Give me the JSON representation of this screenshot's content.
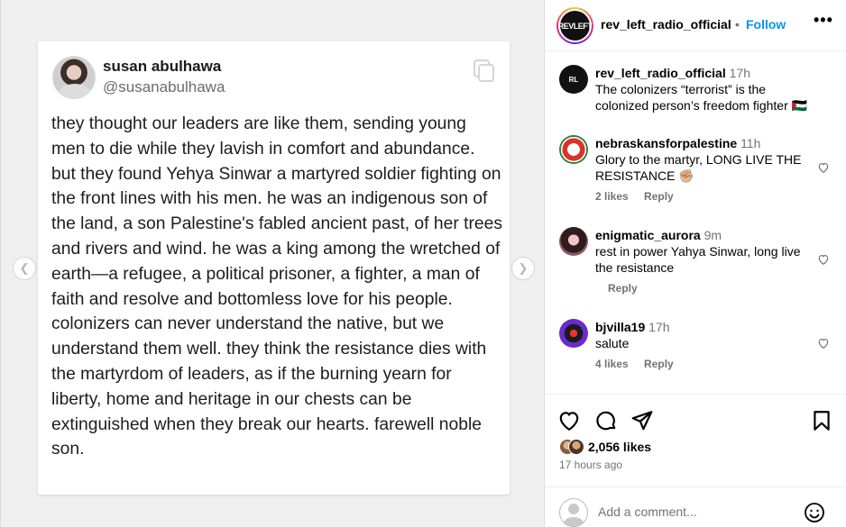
{
  "tweet": {
    "name": "susan abulhawa",
    "handle": "@susanabulhawa",
    "text": "they thought our leaders are like them, sending young men to die while they lavish in comfort and abundance. but they found Yehya Sinwar a martyred soldier fighting on the front lines with his men. he was an indigenous son of the land, a son Palestine's fabled ancient past, of her trees and rivers and wind. he was a king among the wretched of earth—a refugee, a political prisoner, a fighter, a man of faith and resolve and bottomless love for his people. colonizers can never understand the native, but we understand them well. they think the resistance dies with the martyrdom of leaders, as if the burning yearn for liberty, home and heritage in our chests can be extinguished when they break our hearts. farewell noble son."
  },
  "carousel": {
    "prev_icon": "chevron-left-icon",
    "next_icon": "chevron-right-icon"
  },
  "post": {
    "username": "rev_left_radio_official",
    "separator": "•",
    "follow_label": "Follow",
    "more_label": "•••",
    "avatar_text": "REVLEFT"
  },
  "comments": [
    {
      "user": "rev_left_radio_official",
      "time": "17h",
      "text": "The colonizers “terrorist” is the colonized person’s freedom fighter 🇵🇸",
      "likes": "",
      "reply": ""
    },
    {
      "user": "nebraskansforpalestine",
      "time": "11h",
      "text": "Glory to the martyr, LONG LIVE THE RESISTANCE ✊🏼",
      "likes": "2 likes",
      "reply": "Reply"
    },
    {
      "user": "enigmatic_aurora",
      "time": "9m",
      "text": "rest in power Yahya Sinwar, long live the resistance",
      "likes": "",
      "reply": "Reply"
    },
    {
      "user": "bjvilla19",
      "time": "17h",
      "text": "salute",
      "likes": "4 likes",
      "reply": "Reply"
    }
  ],
  "stats": {
    "likes": "2,056 likes",
    "time_ago": "17 hours ago"
  },
  "add_comment": {
    "placeholder": "Add a comment..."
  },
  "colors": {
    "accent": "#0095f6",
    "muted": "#737373",
    "border": "#dbdbdb"
  }
}
